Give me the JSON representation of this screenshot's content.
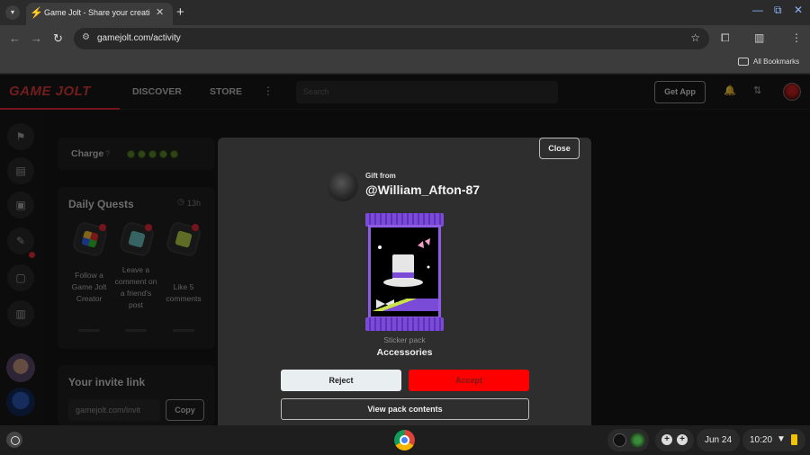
{
  "browser": {
    "tab_title": "Game Jolt - Share your creations",
    "url": "gamejolt.com/activity",
    "bookmarks_label": "All Bookmarks"
  },
  "site": {
    "logo": "GAME JOLT",
    "nav": {
      "discover": "DISCOVER",
      "store": "STORE"
    },
    "search_placeholder": "Search",
    "get_app": "Get App",
    "colors": {
      "brand_red": "#e8293a",
      "accept_red": "#ff0000",
      "charge_green": "#5c8a2a"
    }
  },
  "sidebar_cards": {
    "charge_label": "Charge",
    "daily_quests": {
      "title": "Daily Quests",
      "time_left": "13h",
      "quests": [
        {
          "label": "Follow a Game Jolt Creator"
        },
        {
          "label": "Leave a comment on a friend's post"
        },
        {
          "label": "Like 5 comments"
        }
      ]
    },
    "invite": {
      "title": "Your invite link",
      "link_value": "gamejolt.com/invit",
      "copy": "Copy"
    }
  },
  "gift_modal": {
    "close": "Close",
    "gift_from_label": "Gift from",
    "gift_user": "@William_Afton-87",
    "pack_type": "Sticker pack",
    "pack_name": "Accessories",
    "reject": "Reject",
    "accept": "Accept",
    "view_contents": "View pack contents"
  },
  "taskbar": {
    "date": "Jun 24",
    "time": "10:20"
  }
}
